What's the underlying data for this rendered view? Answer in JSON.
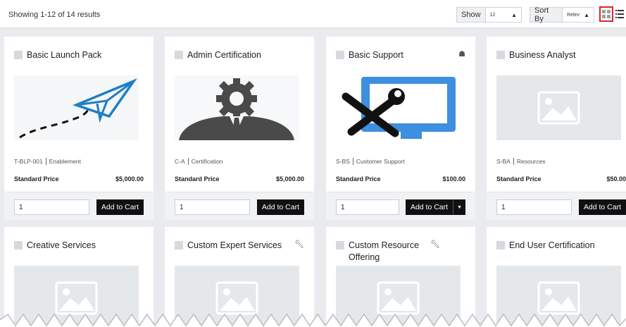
{
  "toolbar": {
    "results_text": "Showing 1-12 of 14 results",
    "show_label": "Show",
    "show_value": "12",
    "sort_label": "Sort By",
    "sort_value": "Relev",
    "grid_view_icon": "grid-icon",
    "list_view_icon": "list-icon"
  },
  "colors": {
    "accent_border": "#d9262b",
    "button_bg": "#111111",
    "placeholder_gray": "#e5e8eb"
  },
  "products": [
    {
      "title": "Basic Launch Pack",
      "icon": "",
      "image": "paper-plane",
      "code": "T-BLP-001",
      "category": "Enablement",
      "price_label": "Standard Price",
      "price": "$5,000.00",
      "qty": "1",
      "cart_label": "Add to Cart",
      "dropdown": false
    },
    {
      "title": "Admin Certification",
      "icon": "",
      "image": "gear-person",
      "code": "C-A",
      "category": "Certification",
      "price_label": "Standard Price",
      "price": "$5,000.00",
      "qty": "1",
      "cart_label": "Add to Cart",
      "dropdown": false
    },
    {
      "title": "Basic Support",
      "icon": "bundle-icon",
      "image": "monitor-tools",
      "code": "S-BS",
      "category": "Customer Support",
      "price_label": "Standard Price",
      "price": "$100.00",
      "qty": "1",
      "cart_label": "Add to Cart",
      "dropdown": true
    },
    {
      "title": "Business Analyst",
      "icon": "",
      "image": "placeholder",
      "code": "S-BA",
      "category": "Resources",
      "price_label": "Standard Price",
      "price": "$50.00",
      "qty": "1",
      "cart_label": "Add to Cart",
      "dropdown": false
    },
    {
      "title": "Creative Services",
      "icon": "",
      "image": "placeholder"
    },
    {
      "title": "Custom Expert Services",
      "icon": "wrench-icon",
      "image": "placeholder"
    },
    {
      "title": "Custom Resource Offering",
      "icon": "wrench-icon",
      "image": "placeholder"
    },
    {
      "title": "End User Certification",
      "icon": "",
      "image": "placeholder"
    }
  ]
}
